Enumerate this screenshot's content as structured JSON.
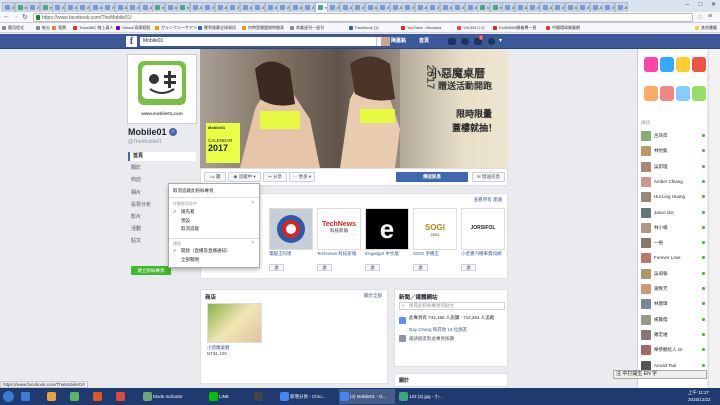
{
  "browser": {
    "tabs": [
      {
        "label": "Apo",
        "color": "#7a9bd1"
      },
      {
        "label": "Ing",
        "color": "#4a8"
      },
      {
        "label": "Apo",
        "color": "#7a9bd1"
      },
      {
        "label": "Ing",
        "color": "#4a8"
      },
      {
        "label": "Apo",
        "color": "#7a9bd1"
      },
      {
        "label": "Apo",
        "color": "#7a9bd1"
      },
      {
        "label": "Apo",
        "color": "#7a9bd1"
      },
      {
        "label": "Apo",
        "color": "#7a9bd1"
      },
      {
        "label": "Apo",
        "color": "#7a9bd1"
      },
      {
        "label": "Apo",
        "color": "#7a9bd1"
      },
      {
        "label": "Apo",
        "color": "#7a9bd1"
      },
      {
        "label": "Apo",
        "color": "#7a9bd1"
      },
      {
        "label": "Ing",
        "color": "#4a8"
      },
      {
        "label": "Apo",
        "color": "#7a9bd1"
      },
      {
        "label": "Ing",
        "color": "#4a8"
      },
      {
        "label": "Apo",
        "color": "#7a9bd1"
      },
      {
        "label": "Apo",
        "color": "#7a9bd1"
      },
      {
        "label": "Apo",
        "color": "#7a9bd1"
      },
      {
        "label": "Apo",
        "color": "#7a9bd1"
      },
      {
        "label": "Apo",
        "color": "#7a9bd1"
      },
      {
        "label": "Apo",
        "color": "#7a9bd1"
      },
      {
        "label": "Apo",
        "color": "#7a9bd1"
      },
      {
        "label": "Apo",
        "color": "#7a9bd1"
      },
      {
        "label": "Apo",
        "color": "#7a9bd1"
      },
      {
        "label": "Apo",
        "color": "#7a9bd1"
      },
      {
        "label": "Ing",
        "color": "#4a8"
      },
      {
        "label": "Apo",
        "color": "#7a9bd1"
      },
      {
        "label": "Apo",
        "color": "#7a9bd1"
      },
      {
        "label": "Apo",
        "color": "#7a9bd1"
      },
      {
        "label": "Apo",
        "color": "#7a9bd1"
      },
      {
        "label": "Apo",
        "color": "#7a9bd1"
      },
      {
        "label": "Apo",
        "color": "#7a9bd1"
      },
      {
        "label": "Apo",
        "color": "#7a9bd1"
      },
      {
        "label": "Apo",
        "color": "#7a9bd1"
      },
      {
        "label": "Apo",
        "color": "#7a9bd1"
      },
      {
        "label": "Apo",
        "color": "#7a9bd1"
      },
      {
        "label": "Apo",
        "color": "#7a9bd1"
      },
      {
        "label": "Apo",
        "color": "#7a9bd1"
      },
      {
        "label": "Ing",
        "color": "#4a8"
      },
      {
        "label": "Ing",
        "color": "#4a8"
      },
      {
        "label": "Apo",
        "color": "#7a9bd1"
      },
      {
        "label": "Apo",
        "color": "#7a9bd1"
      },
      {
        "label": "Apo",
        "color": "#7a9bd1"
      },
      {
        "label": "Apo",
        "color": "#7a9bd1"
      },
      {
        "label": "Apo",
        "color": "#7a9bd1"
      },
      {
        "label": "Apo",
        "color": "#7a9bd1"
      },
      {
        "label": "Apo",
        "color": "#7a9bd1"
      },
      {
        "label": "Apo",
        "color": "#7a9bd1"
      },
      {
        "label": "Apo",
        "color": "#7a9bd1"
      },
      {
        "label": "Apo",
        "color": "#7a9bd1"
      }
    ],
    "url": "https://www.facebook.com/TheMobile01/",
    "bookmarks": [
      {
        "label": "應用程式",
        "color": "#888"
      },
      {
        "label": "新分",
        "color": "#888"
      },
      {
        "label": "我賣",
        "color": "#e74"
      },
      {
        "label": "TutorABC 線上真人",
        "color": "#d33"
      },
      {
        "label": "Yahoo!奇摩個股",
        "color": "#70c"
      },
      {
        "label": "ガランクシーケアン",
        "color": "#e90"
      },
      {
        "label": "匯率換算全球資訊",
        "color": "#36a"
      },
      {
        "label": "何時是開盤總時間表",
        "color": "#e90"
      },
      {
        "label": "商業週刊一週刊",
        "color": "#888"
      },
      {
        "label": "Facebook (1)",
        "color": "#3b5998"
      },
      {
        "label": "YouTube - Broadca",
        "color": "#e22"
      },
      {
        "label": "YVLEN C.O.",
        "color": "#e44"
      },
      {
        "label": "EUN5500開箱專一頁",
        "color": "#d22"
      },
      {
        "label": "中國環球開業網",
        "color": "#e33"
      },
      {
        "label": "其他書籤",
        "color": "#fc3"
      }
    ]
  },
  "fb_header": {
    "search_value": "Mobile01",
    "user_name": "陳嘉銘",
    "home_label": "首頁",
    "notif_count": "2"
  },
  "page": {
    "name": "Mobile01",
    "handle": "@TheMobile01",
    "logo_url_text": "www.mobile01.com",
    "nav": [
      "首頁",
      "關於",
      "商店",
      "相片",
      "影片",
      "活動",
      "貼文",
      "建立粉絲專頁"
    ],
    "nav_active": 0,
    "nav_items": [
      "首頁",
      "關於",
      "商店",
      "相片",
      "投票分析",
      "影片",
      "活動",
      "貼文",
      "關閉"
    ],
    "create_page_btn": "建立粉絲專頁",
    "cover": {
      "title_line1": "小惡魔桌曆",
      "title_line2": "贈送活動開跑",
      "year_big": "2017",
      "promo1": "限時限量",
      "promo2": "蓋樓就抽！",
      "cal_brand": "Mobile01",
      "cal_word": "CALENDAR",
      "cal_year": "2017"
    },
    "actions": {
      "like": "讚",
      "following": "追蹤中",
      "share": "分享",
      "more": "更多",
      "send_message": "傳送訊息",
      "send_button": "發送訊息"
    },
    "dropdown": {
      "header": "取消追蹤此粉絲專頁",
      "section1": "在動態消息中",
      "options1": [
        "搶先看",
        "預設",
        "取消追蹤"
      ],
      "section1_checked": 0,
      "section2": "通知",
      "options2": [
        "開啟（直播及直播通知）",
        "全部關閉"
      ],
      "section2_checked": 0
    },
    "likes_section": {
      "see_all": "查看所有 建議",
      "items": [
        {
          "name": "電腦王阿達",
          "like": "讚"
        },
        {
          "name": "Technews 科技新報",
          "like": "讚"
        },
        {
          "name": "Engadget 中文版",
          "like": "讚"
        },
        {
          "name": "SOGI 手機王",
          "like": "讚"
        },
        {
          "name": "小老婆汽機車資訊網",
          "like": "讚"
        }
      ],
      "logos": [
        "TechNews",
        "科技新報",
        "e",
        "SOGI",
        "2001",
        "JORSIFOL"
      ]
    },
    "shop": {
      "title": "商店",
      "see_all": "顯示全部",
      "item_name": "小惡魔桌曆",
      "item_price": "NT$1,100"
    },
    "news": {
      "title": "新聞／媒體網站",
      "search_placeholder": "搜尋此粉絲專頁的貼文",
      "likes_line": "此專頁有 742,156 人說讚 · 712,264 人追蹤",
      "friends_line": "Day Chang 和其他 19 位朋友",
      "invite_line": "邀請朋友對此專頁按讚"
    },
    "right_labels": {
      "about": "關於",
      "about_see": "查看全部"
    }
  },
  "chat": {
    "section": "通訊",
    "people": [
      {
        "name": "呂琦萍",
        "color": "#8a7"
      },
      {
        "name": "林怡甄",
        "color": "#b96"
      },
      {
        "name": "吳蔚理",
        "color": "#a87"
      },
      {
        "name": "Amber Chiang",
        "color": "#c98"
      },
      {
        "name": "Hui Ling Huang",
        "color": "#987"
      },
      {
        "name": "Jason Din",
        "color": "#677"
      },
      {
        "name": "林小楊",
        "color": "#a98"
      },
      {
        "name": "一裕",
        "color": "#876"
      },
      {
        "name": "Forever Love",
        "color": "#b76"
      },
      {
        "name": "吳堉翰",
        "color": "#a96"
      },
      {
        "name": "謝晚芳",
        "color": "#c97"
      },
      {
        "name": "林健琿",
        "color": "#789"
      },
      {
        "name": "楊賢儒",
        "color": "#998"
      },
      {
        "name": "羅宏維",
        "color": "#877"
      },
      {
        "name": "樂參觀結人 GI",
        "color": "#a66"
      },
      {
        "name": "Arnold Tsai",
        "color": "#555"
      }
    ],
    "games": [
      {
        "color": "#f4a"
      },
      {
        "color": "#3af"
      },
      {
        "color": "#fc3"
      },
      {
        "color": "#e54"
      },
      {
        "color": "#fa6"
      },
      {
        "color": "#e88"
      },
      {
        "color": "#8cf"
      },
      {
        "color": "#9d6"
      }
    ],
    "ime_label": "注 中打開生 EN 字"
  },
  "status_url": "https://www.facebook.com/TheMobile01#",
  "taskbar": {
    "items": [
      {
        "label": "",
        "color": "#3a7bd5"
      },
      {
        "label": "",
        "color": "#e8a33a"
      },
      {
        "label": "",
        "color": "#5cb85c"
      },
      {
        "label": "",
        "color": "#e25822"
      },
      {
        "label": "",
        "color": "#dd4b39"
      },
      {
        "label": "Mode Indicator",
        "color": "#6a7"
      },
      {
        "label": "LINE",
        "color": "#00c300"
      },
      {
        "label": "",
        "color": "#444"
      },
      {
        "label": "新增分頁 - Chro...",
        "color": "#4285f4"
      },
      {
        "label": "(4) Mobile01 - G...",
        "color": "#4285f4"
      },
      {
        "label": "123 (2).jpg - 小...",
        "color": "#3a7"
      }
    ],
    "time": "上午 11:27",
    "date": "2016/12/22"
  }
}
